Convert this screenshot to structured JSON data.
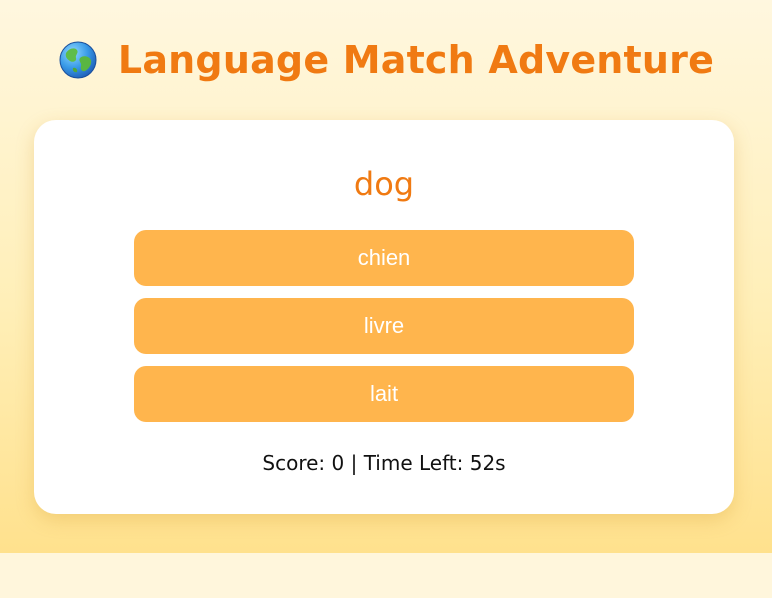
{
  "header": {
    "icon": "globe-icon",
    "title": "Language Match Adventure"
  },
  "question": {
    "word": "dog"
  },
  "options": [
    {
      "label": "chien"
    },
    {
      "label": "livre"
    },
    {
      "label": "lait"
    }
  ],
  "status": {
    "text": "Score: 0 | Time Left: 52s"
  },
  "colors": {
    "accent": "#f07a12",
    "button": "#ffb54d",
    "card": "#ffffff",
    "background_top": "#fff7df",
    "background_bottom": "#ffe18d"
  }
}
